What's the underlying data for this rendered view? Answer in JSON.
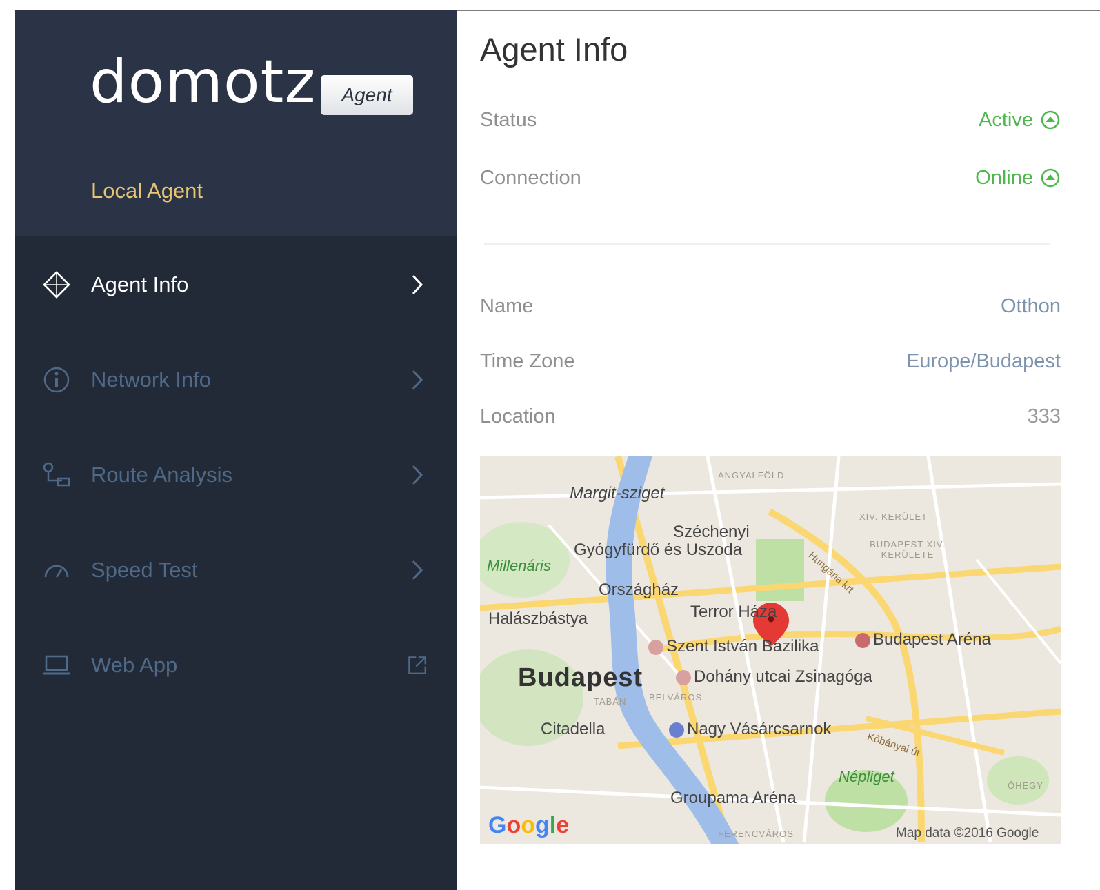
{
  "sidebar": {
    "logo_text": "domotz",
    "badge": "Agent",
    "agent_name": "Local Agent",
    "items": [
      {
        "label": "Agent Info",
        "icon": "diamond-icon",
        "trail": "chevron-right-icon",
        "active": true
      },
      {
        "label": "Network Info",
        "icon": "info-icon",
        "trail": "chevron-right-icon",
        "active": false
      },
      {
        "label": "Route Analysis",
        "icon": "route-icon",
        "trail": "chevron-right-icon",
        "active": false
      },
      {
        "label": "Speed Test",
        "icon": "speedometer-icon",
        "trail": "chevron-right-icon",
        "active": false
      },
      {
        "label": "Web App",
        "icon": "laptop-icon",
        "trail": "external-link-icon",
        "active": false
      }
    ]
  },
  "main": {
    "title": "Agent Info",
    "status": {
      "label": "Status",
      "value": "Active"
    },
    "connection": {
      "label": "Connection",
      "value": "Online"
    },
    "name": {
      "label": "Name",
      "value": "Otthon"
    },
    "timezone": {
      "label": "Time Zone",
      "value": "Europe/Budapest"
    },
    "location": {
      "label": "Location",
      "value": "333"
    }
  },
  "map": {
    "city": "Budapest",
    "labels": {
      "angyalfold": "ANGYALFÖLD",
      "margit": "Margit-sziget",
      "xiv": "XIV. KERÜLET",
      "xiv2": "BUDAPEST XIV. KERÜLETE",
      "szechenyi1": "Széchenyi",
      "szechenyi2": "Gyógyfürdő és Uszoda",
      "millenaris": "Millenáris",
      "orszaghaz": "Országház",
      "terror": "Terror Háza",
      "halaszbastya": "Halászbástya",
      "hungaria": "Hungária krt",
      "bazilika": "Szent István Bazilika",
      "arena": "Budapest Aréna",
      "dohany": "Dohány utcai Zsinagóga",
      "taban": "TABÁN",
      "belvaros": "BELVÁROS",
      "citadella": "Citadella",
      "vasarcsarnok": "Nagy Vásárcsarnok",
      "kobanyai": "Kőbányai út",
      "nepliget": "Népliget",
      "groupama": "Groupama Aréna",
      "ferencvaros": "FERENCVÁROS",
      "ohegy": "ÓHEGY"
    },
    "google": "Google",
    "attribution": "Map data ©2016 Google",
    "colors": {
      "water": "#9ebde9",
      "park": "#bfe0a5",
      "road": "#fbd772",
      "pin": "#e53935",
      "active_green": "#4fb84c"
    }
  }
}
